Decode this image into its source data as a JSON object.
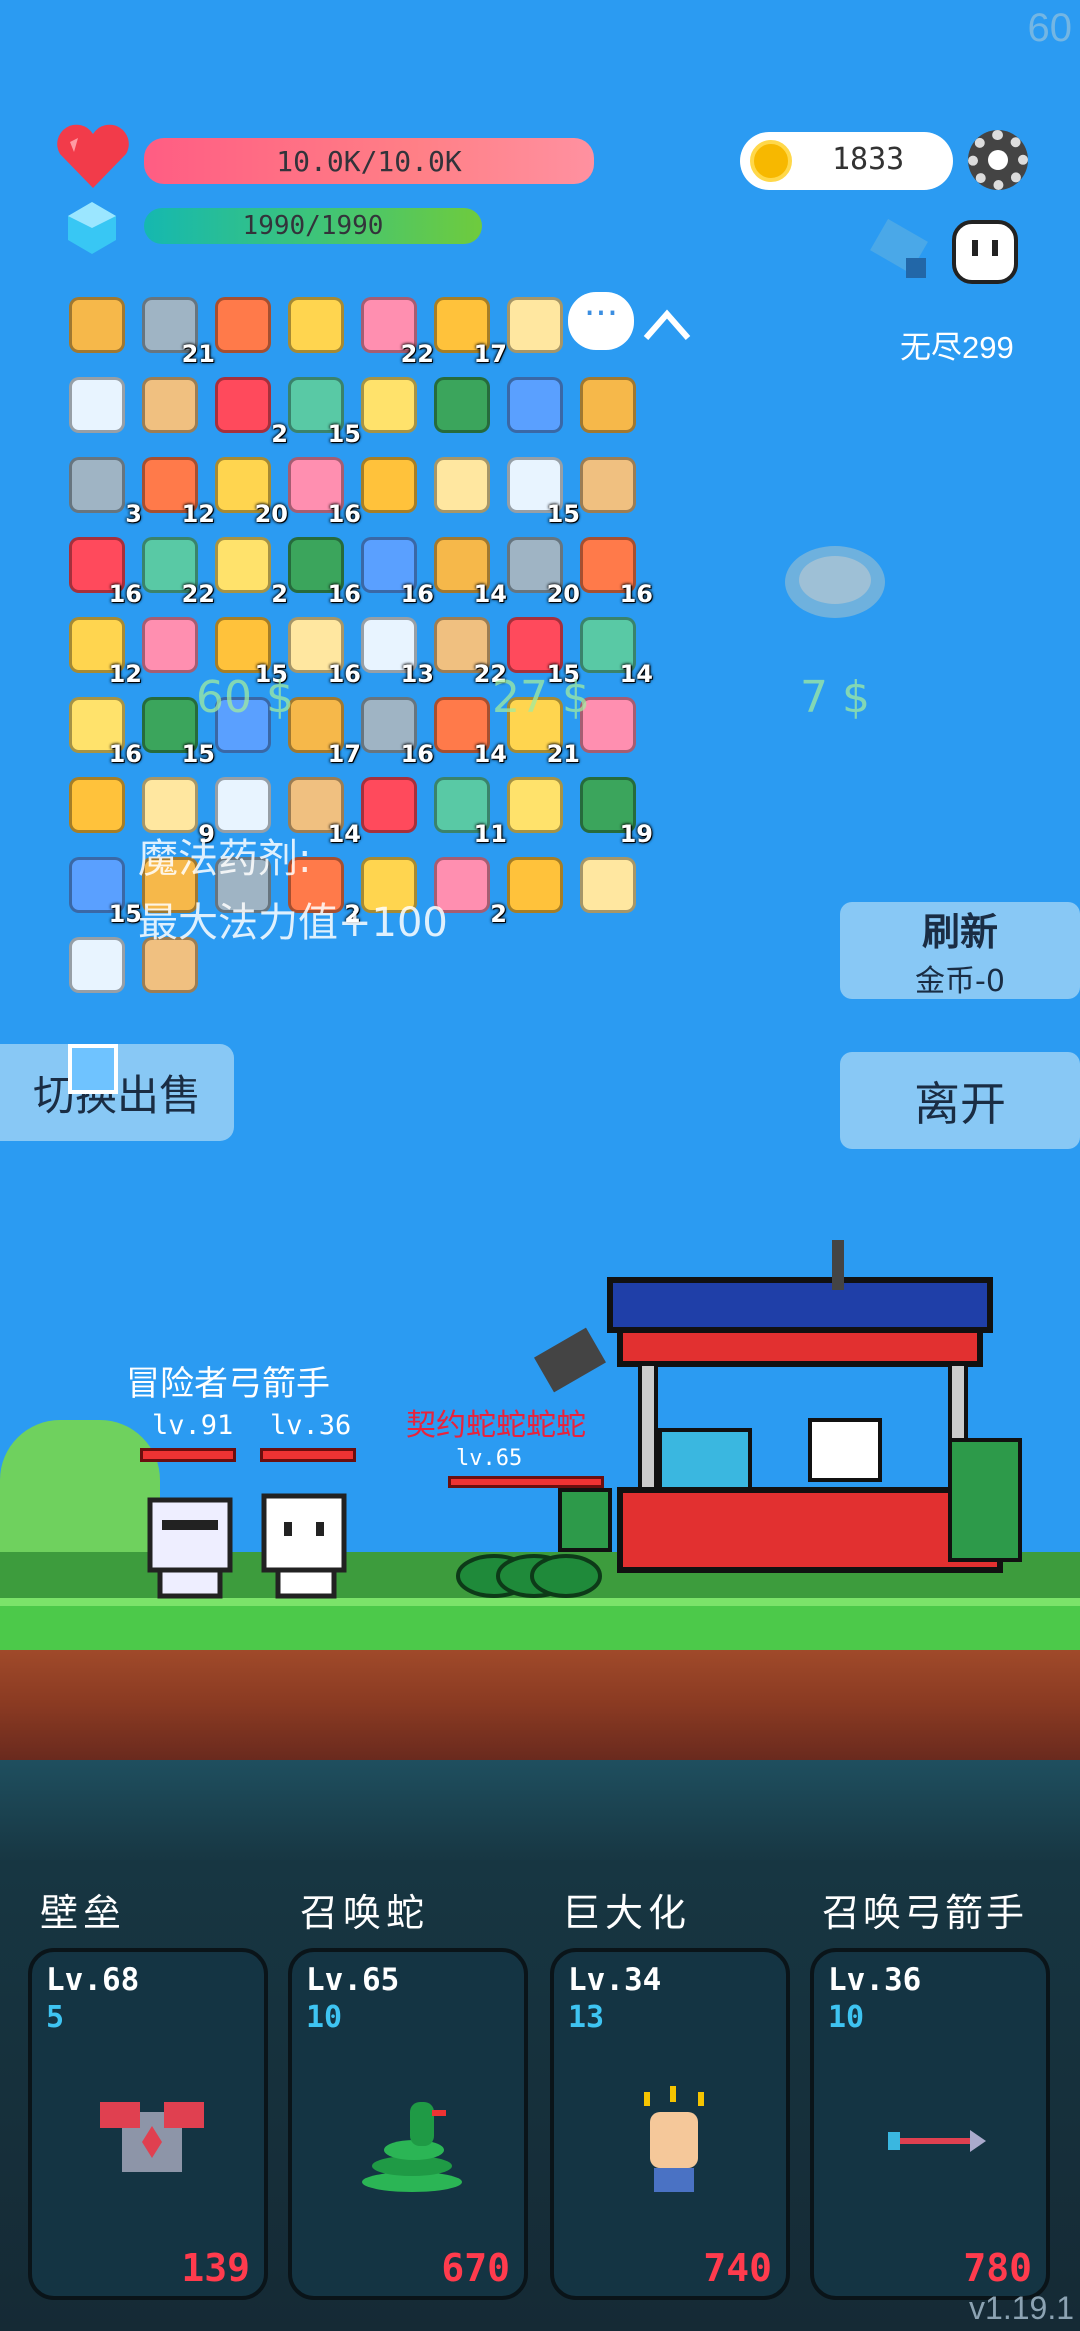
{
  "fps": "60",
  "hud": {
    "hp_text": "10.0K/10.0K",
    "mp_text": "1990/1990",
    "coins": "1833",
    "mode_label": "无尽299"
  },
  "inventory": [
    {
      "icon": "treasure-map-icon",
      "count": ""
    },
    {
      "icon": "disc-icon",
      "count": "21"
    },
    {
      "icon": "tools-icon",
      "count": ""
    },
    {
      "icon": "magnifier-icon",
      "count": ""
    },
    {
      "icon": "flower-icon",
      "count": "22"
    },
    {
      "icon": "sunflower-icon",
      "count": "17"
    },
    {
      "icon": "beer-icon",
      "count": ""
    },
    {
      "icon": "axe-icon",
      "count": ""
    },
    {
      "icon": "shirt-icon",
      "count": ""
    },
    {
      "icon": "briefcase-icon",
      "count": "2"
    },
    {
      "icon": "apple-icon",
      "count": "15"
    },
    {
      "icon": "tent-icon",
      "count": ""
    },
    {
      "icon": "sun-icon",
      "count": ""
    },
    {
      "icon": "snake-icon",
      "count": ""
    },
    {
      "icon": "star-card-icon",
      "count": ""
    },
    {
      "icon": "scroll-icon",
      "count": "3"
    },
    {
      "icon": "meat-icon",
      "count": "12"
    },
    {
      "icon": "spike-ball-icon",
      "count": "20"
    },
    {
      "icon": "tombstone-icon",
      "count": "16"
    },
    {
      "icon": "crystal-ball-icon",
      "count": ""
    },
    {
      "icon": "pineapple-icon",
      "count": ""
    },
    {
      "icon": "meteor-icon",
      "count": "15"
    },
    {
      "icon": "durian-icon",
      "count": ""
    },
    {
      "icon": "red-card-icon",
      "count": "16"
    },
    {
      "icon": "ghost-icon",
      "count": "22"
    },
    {
      "icon": "green-book-icon",
      "count": "2"
    },
    {
      "icon": "strawberry-icon",
      "count": "16"
    },
    {
      "icon": "donut-icon",
      "count": "16"
    },
    {
      "icon": "egg-icon",
      "count": "14"
    },
    {
      "icon": "heart-icon",
      "count": "20"
    },
    {
      "icon": "double-axe-icon",
      "count": "16"
    },
    {
      "icon": "potion-icon",
      "count": "12"
    },
    {
      "icon": "spiral-icon",
      "count": ""
    },
    {
      "icon": "magnet-icon",
      "count": "15"
    },
    {
      "icon": "spray-icon",
      "count": "16"
    },
    {
      "icon": "watermelon-icon",
      "count": "13"
    },
    {
      "icon": "pirate-ship-icon",
      "count": "22"
    },
    {
      "icon": "coin-stack-icon",
      "count": "15"
    },
    {
      "icon": "coconut-icon",
      "count": "14"
    },
    {
      "icon": "money-icon",
      "count": "16"
    },
    {
      "icon": "book-icon",
      "count": "15"
    },
    {
      "icon": "chain-icon",
      "count": ""
    },
    {
      "icon": "letter-icon",
      "count": "17"
    },
    {
      "icon": "pen-icon",
      "count": "16"
    },
    {
      "icon": "bread-icon",
      "count": "14"
    },
    {
      "icon": "drink-icon",
      "count": "21"
    },
    {
      "icon": "list-icon",
      "count": ""
    },
    {
      "icon": "heat-icon",
      "count": ""
    },
    {
      "icon": "pill-icon",
      "count": "9"
    },
    {
      "icon": "crown-icon",
      "count": ""
    },
    {
      "icon": "rainbow-icon",
      "count": "14"
    },
    {
      "icon": "ice-cream-icon",
      "count": ""
    },
    {
      "icon": "capsule-icon",
      "count": "11"
    },
    {
      "icon": "tea-icon",
      "count": ""
    },
    {
      "icon": "jam-icon",
      "count": "19"
    },
    {
      "icon": "sword-icon",
      "count": "15"
    },
    {
      "icon": "cards-icon",
      "count": ""
    },
    {
      "icon": "gem-icon",
      "count": ""
    },
    {
      "icon": "dots-icon",
      "count": "2"
    },
    {
      "icon": "pin-icon",
      "count": ""
    },
    {
      "icon": "dice-icon",
      "count": "2"
    },
    {
      "icon": "parchment-icon",
      "count": ""
    },
    {
      "icon": "bulb-icon",
      "count": ""
    },
    {
      "icon": "map-icon",
      "count": ""
    },
    {
      "icon": "crown-small-icon",
      "count": ""
    }
  ],
  "floats": {
    "price1": "60 $",
    "price2": "27 $",
    "price3": "7 $",
    "tip_title": "魔法药剂:",
    "tip_desc": "最大法力值+100"
  },
  "buttons": {
    "refresh_title": "刷新",
    "refresh_cost": "金币-0",
    "leave": "离开",
    "switch_sell": "切换出售"
  },
  "scene": {
    "ally_label": "冒险者弓箭手",
    "ally1_lv": "lv.91",
    "ally2_lv": "lv.36",
    "enemy_label": "契约蛇蛇蛇蛇",
    "enemy_lv": "lv.65"
  },
  "skills": [
    {
      "name": "壁垒",
      "lv": "Lv.68",
      "cost": "5",
      "value": "139",
      "icon": "armor-icon"
    },
    {
      "name": "召唤蛇",
      "lv": "Lv.65",
      "cost": "10",
      "value": "670",
      "icon": "snake-icon"
    },
    {
      "name": "巨大化",
      "lv": "Lv.34",
      "cost": "13",
      "value": "740",
      "icon": "fist-icon"
    },
    {
      "name": "召唤弓箭手",
      "lv": "Lv.36",
      "cost": "10",
      "value": "780",
      "icon": "arrow-icon"
    }
  ],
  "version": "v1.19.1"
}
